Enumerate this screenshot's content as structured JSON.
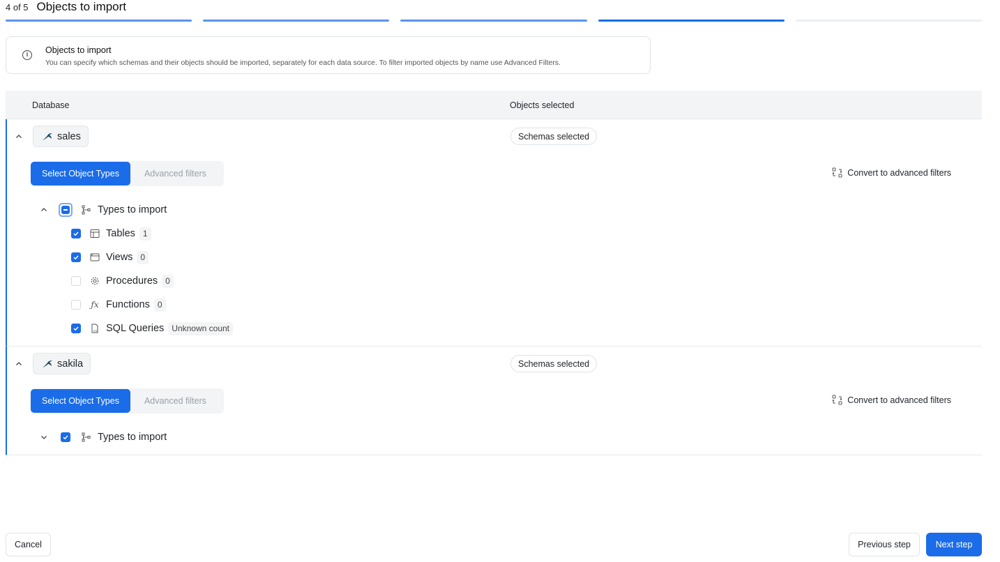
{
  "header": {
    "step_counter": "4 of 5",
    "title": "Objects to import",
    "progress": {
      "total_steps": 5,
      "current_step": 4
    }
  },
  "info": {
    "title": "Objects to import",
    "description": "You can specify which schemas and their objects should be imported, separately for each data source. To filter imported objects by name use Advanced Filters."
  },
  "table": {
    "col_database": "Database",
    "col_objects": "Objects selected"
  },
  "databases": [
    {
      "name": "sales",
      "selection": "Schemas selected",
      "tab_active": "Select Object Types",
      "tab_inactive": "Advanced filters",
      "convert_label": "Convert to advanced filters",
      "tree_label": "Types to import",
      "types": [
        {
          "label": "Tables",
          "count": "1",
          "checked": true
        },
        {
          "label": "Views",
          "count": "0",
          "checked": true
        },
        {
          "label": "Procedures",
          "count": "0",
          "checked": false
        },
        {
          "label": "Functions",
          "count": "0",
          "checked": false
        },
        {
          "label": "SQL Queries",
          "count": "Unknown count",
          "checked": true
        }
      ]
    },
    {
      "name": "sakila",
      "selection": "Schemas selected",
      "tab_active": "Select Object Types",
      "tab_inactive": "Advanced filters",
      "convert_label": "Convert to advanced filters",
      "tree_label": "Types to import"
    }
  ],
  "footer": {
    "cancel": "Cancel",
    "previous": "Previous step",
    "next": "Next step"
  },
  "colors": {
    "accent": "#1a6ce8",
    "progress_done": "#5a93ee",
    "track": "#eceff3"
  }
}
